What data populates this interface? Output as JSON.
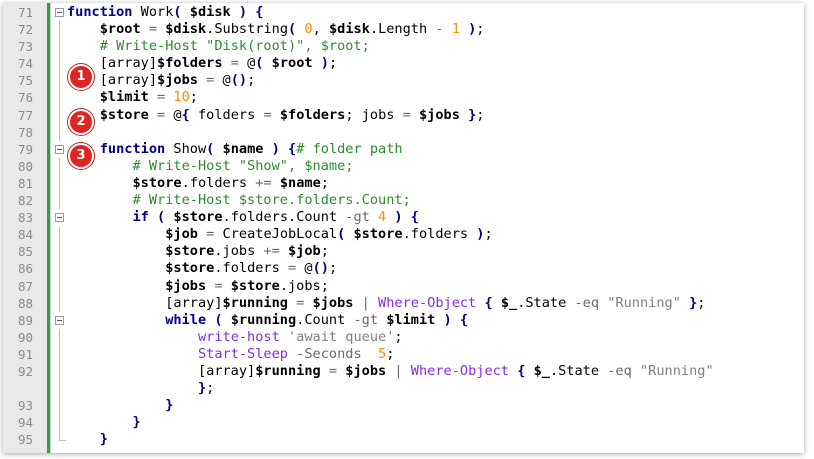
{
  "editor": {
    "badges": [
      "1",
      "2",
      "3"
    ],
    "lines": [
      {
        "n": "71",
        "tokens": [
          [
            "kw",
            "function"
          ],
          [
            "t",
            " Work"
          ],
          [
            "pun",
            "("
          ],
          [
            "t",
            " "
          ],
          [
            "var",
            "$disk"
          ],
          [
            "t",
            " "
          ],
          [
            "pun",
            ")"
          ],
          [
            "t",
            " "
          ],
          [
            "pun",
            "{"
          ]
        ]
      },
      {
        "n": "72",
        "tokens": [
          [
            "t",
            "    "
          ],
          [
            "var",
            "$root"
          ],
          [
            "t",
            " "
          ],
          [
            "op",
            "="
          ],
          [
            "t",
            " "
          ],
          [
            "var",
            "$disk"
          ],
          [
            "t",
            "."
          ],
          [
            "prop",
            "Substring"
          ],
          [
            "pun",
            "("
          ],
          [
            "t",
            " "
          ],
          [
            "num",
            "0"
          ],
          [
            "t",
            ", "
          ],
          [
            "var",
            "$disk"
          ],
          [
            "t",
            "."
          ],
          [
            "prop",
            "Length"
          ],
          [
            "t",
            " "
          ],
          [
            "op",
            "-"
          ],
          [
            "t",
            " "
          ],
          [
            "num",
            "1"
          ],
          [
            "t",
            " "
          ],
          [
            "pun",
            ")"
          ],
          [
            "t",
            ";"
          ]
        ]
      },
      {
        "n": "73",
        "tokens": [
          [
            "t",
            "    "
          ],
          [
            "cmt",
            "# Write-Host \"Disk(root)\", $root;"
          ]
        ]
      },
      {
        "n": "74",
        "tokens": [
          [
            "t",
            "    [array]"
          ],
          [
            "var",
            "$folders"
          ],
          [
            "t",
            " "
          ],
          [
            "op",
            "="
          ],
          [
            "t",
            " @"
          ],
          [
            "pun",
            "("
          ],
          [
            "t",
            " "
          ],
          [
            "var",
            "$root"
          ],
          [
            "t",
            " "
          ],
          [
            "pun",
            ")"
          ],
          [
            "t",
            ";"
          ]
        ]
      },
      {
        "n": "75",
        "tokens": [
          [
            "t",
            "    [array]"
          ],
          [
            "var",
            "$jobs"
          ],
          [
            "t",
            " "
          ],
          [
            "op",
            "="
          ],
          [
            "t",
            " @"
          ],
          [
            "pun",
            "()"
          ],
          [
            "t",
            ";"
          ]
        ]
      },
      {
        "n": "76",
        "tokens": [
          [
            "t",
            "    "
          ],
          [
            "var",
            "$limit"
          ],
          [
            "t",
            " "
          ],
          [
            "op",
            "="
          ],
          [
            "t",
            " "
          ],
          [
            "num",
            "10"
          ],
          [
            "t",
            ";"
          ]
        ]
      },
      {
        "n": "77",
        "tokens": [
          [
            "t",
            "    "
          ],
          [
            "var",
            "$store"
          ],
          [
            "t",
            " "
          ],
          [
            "op",
            "="
          ],
          [
            "t",
            " @"
          ],
          [
            "pun",
            "{"
          ],
          [
            "t",
            " folders "
          ],
          [
            "op",
            "="
          ],
          [
            "t",
            " "
          ],
          [
            "var",
            "$folders"
          ],
          [
            "t",
            "; jobs "
          ],
          [
            "op",
            "="
          ],
          [
            "t",
            " "
          ],
          [
            "var",
            "$jobs"
          ],
          [
            "t",
            " "
          ],
          [
            "pun",
            "}"
          ],
          [
            "t",
            ";"
          ]
        ]
      },
      {
        "n": "78",
        "tokens": []
      },
      {
        "n": "79",
        "tokens": [
          [
            "t",
            "    "
          ],
          [
            "kw",
            "function"
          ],
          [
            "t",
            " Show"
          ],
          [
            "pun",
            "("
          ],
          [
            "t",
            " "
          ],
          [
            "var",
            "$name"
          ],
          [
            "t",
            " "
          ],
          [
            "pun",
            ")"
          ],
          [
            "t",
            " "
          ],
          [
            "pun",
            "{"
          ],
          [
            "cmt",
            "# folder path"
          ]
        ]
      },
      {
        "n": "80",
        "tokens": [
          [
            "t",
            "        "
          ],
          [
            "cmt",
            "# Write-Host \"Show\", $name;"
          ]
        ]
      },
      {
        "n": "81",
        "tokens": [
          [
            "t",
            "        "
          ],
          [
            "var",
            "$store"
          ],
          [
            "t",
            ".folders "
          ],
          [
            "op",
            "+="
          ],
          [
            "t",
            " "
          ],
          [
            "var",
            "$name"
          ],
          [
            "t",
            ";"
          ]
        ]
      },
      {
        "n": "82",
        "tokens": [
          [
            "t",
            "        "
          ],
          [
            "cmt",
            "# Write-Host $store.folders.Count;"
          ]
        ]
      },
      {
        "n": "83",
        "tokens": [
          [
            "t",
            "        "
          ],
          [
            "kw",
            "if"
          ],
          [
            "t",
            " "
          ],
          [
            "pun",
            "("
          ],
          [
            "t",
            " "
          ],
          [
            "var",
            "$store"
          ],
          [
            "t",
            ".folders.Count "
          ],
          [
            "op",
            "-gt"
          ],
          [
            "t",
            " "
          ],
          [
            "num",
            "4"
          ],
          [
            "t",
            " "
          ],
          [
            "pun",
            ")"
          ],
          [
            "t",
            " "
          ],
          [
            "pun",
            "{"
          ]
        ]
      },
      {
        "n": "84",
        "tokens": [
          [
            "t",
            "            "
          ],
          [
            "var",
            "$job"
          ],
          [
            "t",
            " "
          ],
          [
            "op",
            "="
          ],
          [
            "t",
            " CreateJobLocal"
          ],
          [
            "pun",
            "("
          ],
          [
            "t",
            " "
          ],
          [
            "var",
            "$store"
          ],
          [
            "t",
            ".folders "
          ],
          [
            "pun",
            ")"
          ],
          [
            "t",
            ";"
          ]
        ]
      },
      {
        "n": "85",
        "tokens": [
          [
            "t",
            "            "
          ],
          [
            "var",
            "$store"
          ],
          [
            "t",
            ".jobs "
          ],
          [
            "op",
            "+="
          ],
          [
            "t",
            " "
          ],
          [
            "var",
            "$job"
          ],
          [
            "t",
            ";"
          ]
        ]
      },
      {
        "n": "86",
        "tokens": [
          [
            "t",
            "            "
          ],
          [
            "var",
            "$store"
          ],
          [
            "t",
            ".folders "
          ],
          [
            "op",
            "="
          ],
          [
            "t",
            " @"
          ],
          [
            "pun",
            "()"
          ],
          [
            "t",
            ";"
          ]
        ]
      },
      {
        "n": "87",
        "tokens": [
          [
            "t",
            "            "
          ],
          [
            "var",
            "$jobs"
          ],
          [
            "t",
            " "
          ],
          [
            "op",
            "="
          ],
          [
            "t",
            " "
          ],
          [
            "var",
            "$store"
          ],
          [
            "t",
            ".jobs;"
          ]
        ]
      },
      {
        "n": "88",
        "tokens": [
          [
            "t",
            "            [array]"
          ],
          [
            "var",
            "$running"
          ],
          [
            "t",
            " "
          ],
          [
            "op",
            "="
          ],
          [
            "t",
            " "
          ],
          [
            "var",
            "$jobs"
          ],
          [
            "t",
            " "
          ],
          [
            "op",
            "|"
          ],
          [
            "t",
            " "
          ],
          [
            "cmd",
            "Where-Object"
          ],
          [
            "t",
            " "
          ],
          [
            "pun",
            "{"
          ],
          [
            "t",
            " "
          ],
          [
            "var",
            "$_"
          ],
          [
            "t",
            ".State "
          ],
          [
            "op",
            "-eq"
          ],
          [
            "t",
            " "
          ],
          [
            "str",
            "\"Running\""
          ],
          [
            "t",
            " "
          ],
          [
            "pun",
            "}"
          ],
          [
            "t",
            ";"
          ]
        ]
      },
      {
        "n": "89",
        "tokens": [
          [
            "t",
            "            "
          ],
          [
            "kw",
            "while"
          ],
          [
            "t",
            " "
          ],
          [
            "pun",
            "("
          ],
          [
            "t",
            " "
          ],
          [
            "var",
            "$running"
          ],
          [
            "t",
            ".Count "
          ],
          [
            "op",
            "-gt"
          ],
          [
            "t",
            " "
          ],
          [
            "var",
            "$limit"
          ],
          [
            "t",
            " "
          ],
          [
            "pun",
            ")"
          ],
          [
            "t",
            " "
          ],
          [
            "pun",
            "{"
          ]
        ]
      },
      {
        "n": "90",
        "tokens": [
          [
            "t",
            "                "
          ],
          [
            "cmd",
            "write-host"
          ],
          [
            "t",
            " "
          ],
          [
            "str",
            "'await queue'"
          ],
          [
            "t",
            ";"
          ]
        ]
      },
      {
        "n": "91",
        "tokens": [
          [
            "t",
            "                "
          ],
          [
            "cmd",
            "Start-Sleep"
          ],
          [
            "t",
            " "
          ],
          [
            "op",
            "-Seconds"
          ],
          [
            "t",
            "  "
          ],
          [
            "num",
            "5"
          ],
          [
            "t",
            ";"
          ]
        ]
      },
      {
        "n": "92",
        "tall": true,
        "tokens": [
          [
            "t",
            "                [array]"
          ],
          [
            "var",
            "$running"
          ],
          [
            "t",
            " "
          ],
          [
            "op",
            "="
          ],
          [
            "t",
            " "
          ],
          [
            "var",
            "$jobs"
          ],
          [
            "t",
            " "
          ],
          [
            "op",
            "|"
          ],
          [
            "t",
            " "
          ],
          [
            "cmd",
            "Where-Object"
          ],
          [
            "t",
            " "
          ],
          [
            "pun",
            "{"
          ],
          [
            "t",
            " "
          ],
          [
            "var",
            "$_"
          ],
          [
            "t",
            ".State "
          ],
          [
            "op",
            "-eq"
          ],
          [
            "t",
            " "
          ],
          [
            "str",
            "\"Running\""
          ],
          [
            "t",
            "\n                "
          ],
          [
            "pun",
            "}"
          ],
          [
            "t",
            ";"
          ]
        ]
      },
      {
        "n": "93",
        "tokens": [
          [
            "t",
            "            "
          ],
          [
            "pun",
            "}"
          ]
        ]
      },
      {
        "n": "94",
        "tokens": [
          [
            "t",
            "        "
          ],
          [
            "pun",
            "}"
          ]
        ]
      },
      {
        "n": "95",
        "tokens": [
          [
            "t",
            "    "
          ],
          [
            "pun",
            "}"
          ]
        ]
      }
    ],
    "colors": {
      "changebar": "#2ea043",
      "badge": "#e02424",
      "keyword": "#00008b",
      "comment": "#2e8b2e",
      "number": "#ff8c00",
      "string": "#808080",
      "cmdlet": "#8a2be2"
    }
  }
}
